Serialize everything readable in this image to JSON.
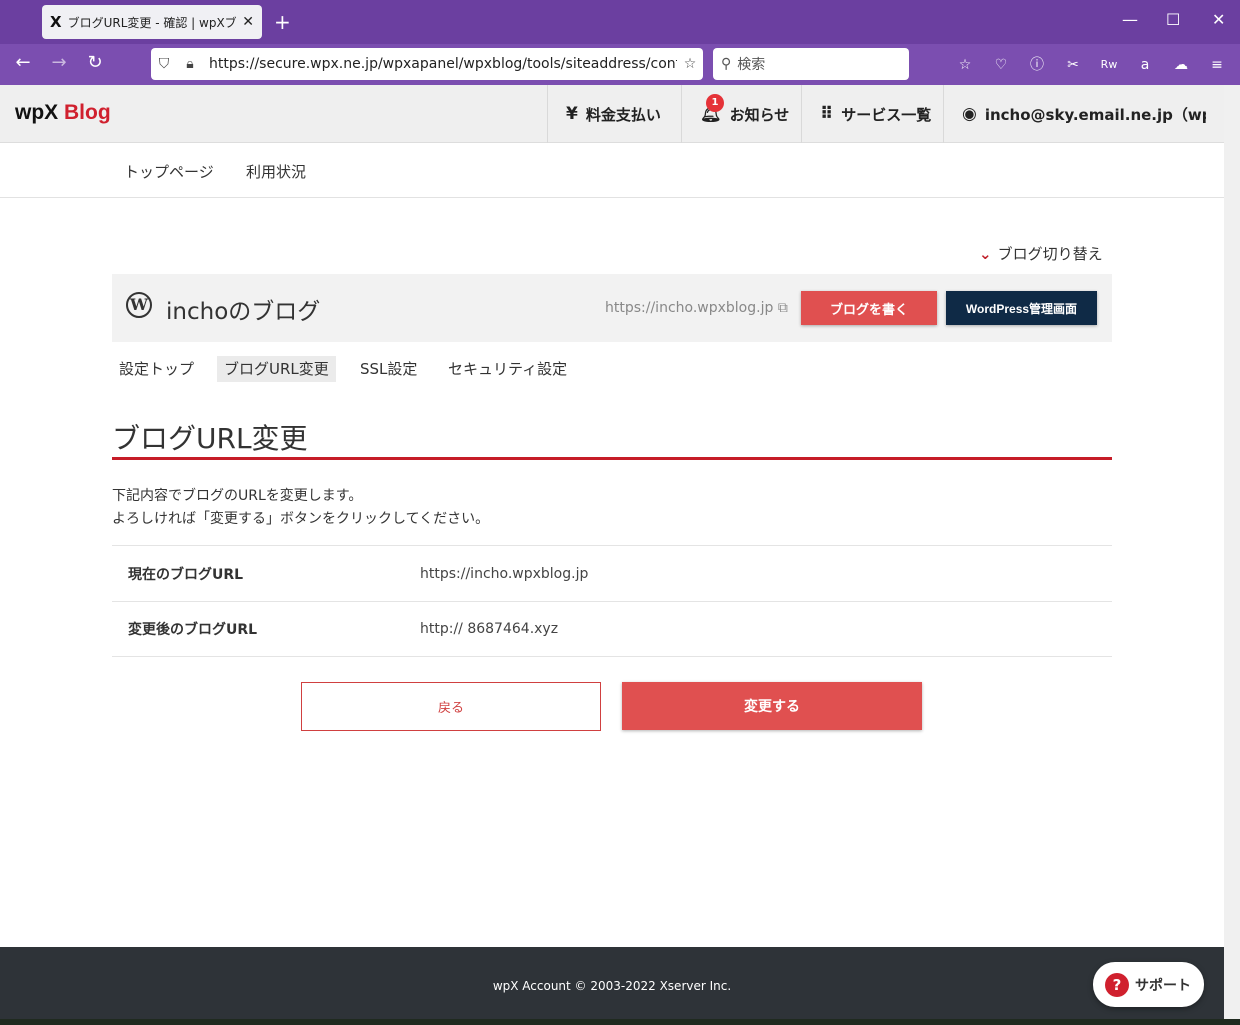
{
  "browser": {
    "tab_title": "ブログURL変更 - 確認 | wpXブログ",
    "tab_close": "✕",
    "new_tab": "+",
    "url": "https://secure.wpx.ne.jp/wpxapanel/wpxblog/tools/siteaddress/conf",
    "search_placeholder": "検索"
  },
  "header": {
    "logo_wpx": "wpX",
    "logo_blog": "Blog",
    "billing": "料金支払い",
    "notifications": "お知らせ",
    "notification_count": "1",
    "services": "サービス一覧",
    "account": "incho@sky.email.ne.jp（wp..."
  },
  "subnav": {
    "top": "トップページ",
    "usage": "利用状況"
  },
  "blog": {
    "switch": "ブログ切り替え",
    "name": "inchoのブログ",
    "url": "https://incho.wpxblog.jp",
    "write_button": "ブログを書く",
    "wp_admin_button": "WordPress管理画面"
  },
  "tabs": [
    "設定トップ",
    "ブログURL変更",
    "SSL設定",
    "セキュリティ設定"
  ],
  "page": {
    "title": "ブログURL変更",
    "desc_line1": "下記内容でブログのURLを変更します。",
    "desc_line2": "よろしければ「変更する」ボタンをクリックしてください。"
  },
  "table": {
    "rows": [
      {
        "label": "現在のブログURL",
        "value": "https://incho.wpxblog.jp"
      },
      {
        "label": "変更後のブログURL",
        "value": "http:// 8687464.xyz"
      }
    ]
  },
  "actions": {
    "back": "戻る",
    "change": "変更する"
  },
  "footer": {
    "copyright": "wpX Account © 2003-2022 Xserver Inc.",
    "support": "サポート"
  },
  "colors": {
    "browser_purple": "#6b3fa0",
    "accent_red": "#e05050",
    "title_line": "#c61c28",
    "wp_button": "#0f2a46",
    "footer": "#2e3338"
  }
}
